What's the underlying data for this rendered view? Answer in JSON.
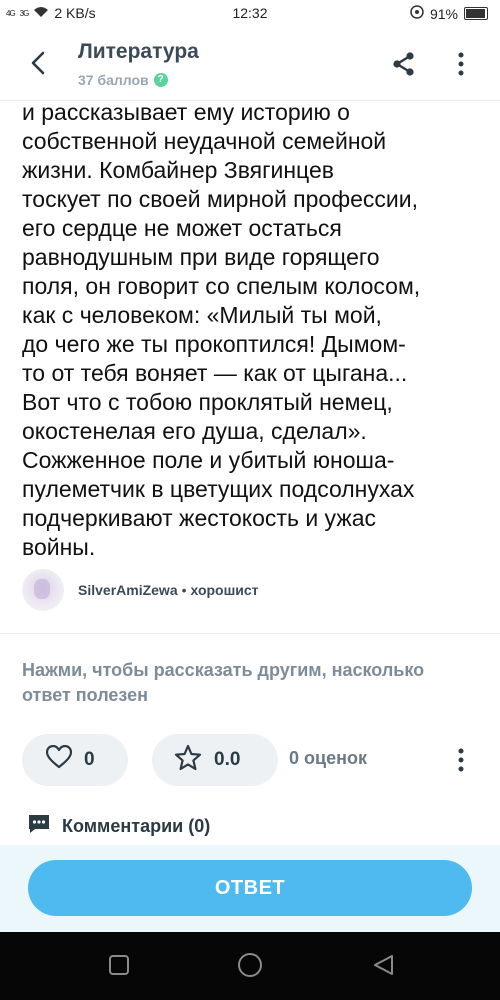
{
  "status_bar": {
    "network": "4G",
    "network2": "3G",
    "speed": "2 KB/s",
    "time": "12:32",
    "battery": "91%"
  },
  "header": {
    "title": "Литература",
    "points": "37 баллов",
    "back_icon": "chevron-left-icon",
    "share_icon": "share-icon",
    "more_icon": "more-vertical-icon"
  },
  "answer": {
    "lines": [
      "и рассказывает ему историю о",
      "собственной неудачной семейной",
      "жизни. Комбайнер Звягинцев",
      "тоскует по своей мирной профессии,",
      "его сердце не может остаться",
      "равнодушным при виде горящего",
      "поля, он говорит со спелым колосом,",
      "как с человеком: «Милый ты мой,",
      "до чего же ты прокоптился! Дымом-",
      "то от тебя воняет — как от цыгана...",
      "Вот что с тобою проклятый немец,",
      "окостенелая его душа, сделал».",
      "Сожженное поле и убитый юноша-",
      "пулеметчик в цветущих подсолнухах",
      "подчеркивают жестокость и ужас",
      "войны."
    ]
  },
  "author": {
    "name": "SilverAmiZewa",
    "separator": "•",
    "rank": "хорошист"
  },
  "feedback": {
    "prompt": "Нажми, чтобы рассказать другим, насколько ответ полезен",
    "likes": "0",
    "rating": "0.0",
    "ratings_count": "0 оценок"
  },
  "comments": {
    "label": "Комментарии (0)"
  },
  "cta": {
    "label": "ОТВЕТ"
  },
  "colors": {
    "accent": "#4fbaf0",
    "title": "#3a4a57",
    "muted": "#7d8c98",
    "help_badge": "#5ad3a0"
  }
}
